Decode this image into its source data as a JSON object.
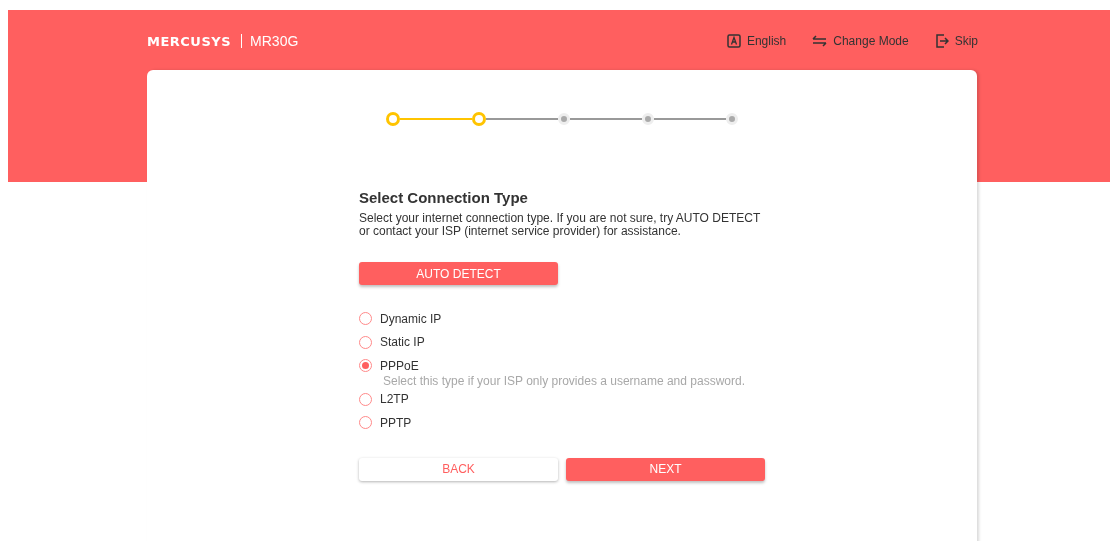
{
  "header": {
    "brand": "MERCUSYS",
    "model": "MR30G",
    "actions": [
      {
        "kind": "language",
        "label": "English"
      },
      {
        "kind": "mode",
        "label": "Change Mode"
      },
      {
        "kind": "skip",
        "label": "Skip"
      }
    ]
  },
  "steps": [
    {
      "done": true
    },
    {
      "done": true
    },
    {
      "done": false
    },
    {
      "done": false
    },
    {
      "done": false
    }
  ],
  "title": "Select Connection Type",
  "description": "Select your internet connection type. If you are not sure, try AUTO DETECT or contact your ISP (internet service provider) for assistance.",
  "auto_detect": "AUTO DETECT",
  "options": [
    {
      "label": "Dynamic IP",
      "selected": false
    },
    {
      "label": "Static IP",
      "selected": false
    },
    {
      "label": "PPPoE",
      "selected": true,
      "hint": "Select this type if your ISP only provides a username and password."
    },
    {
      "label": "L2TP",
      "selected": false
    },
    {
      "label": "PPTP",
      "selected": false
    }
  ],
  "buttons": {
    "back": "BACK",
    "next": "NEXT"
  }
}
